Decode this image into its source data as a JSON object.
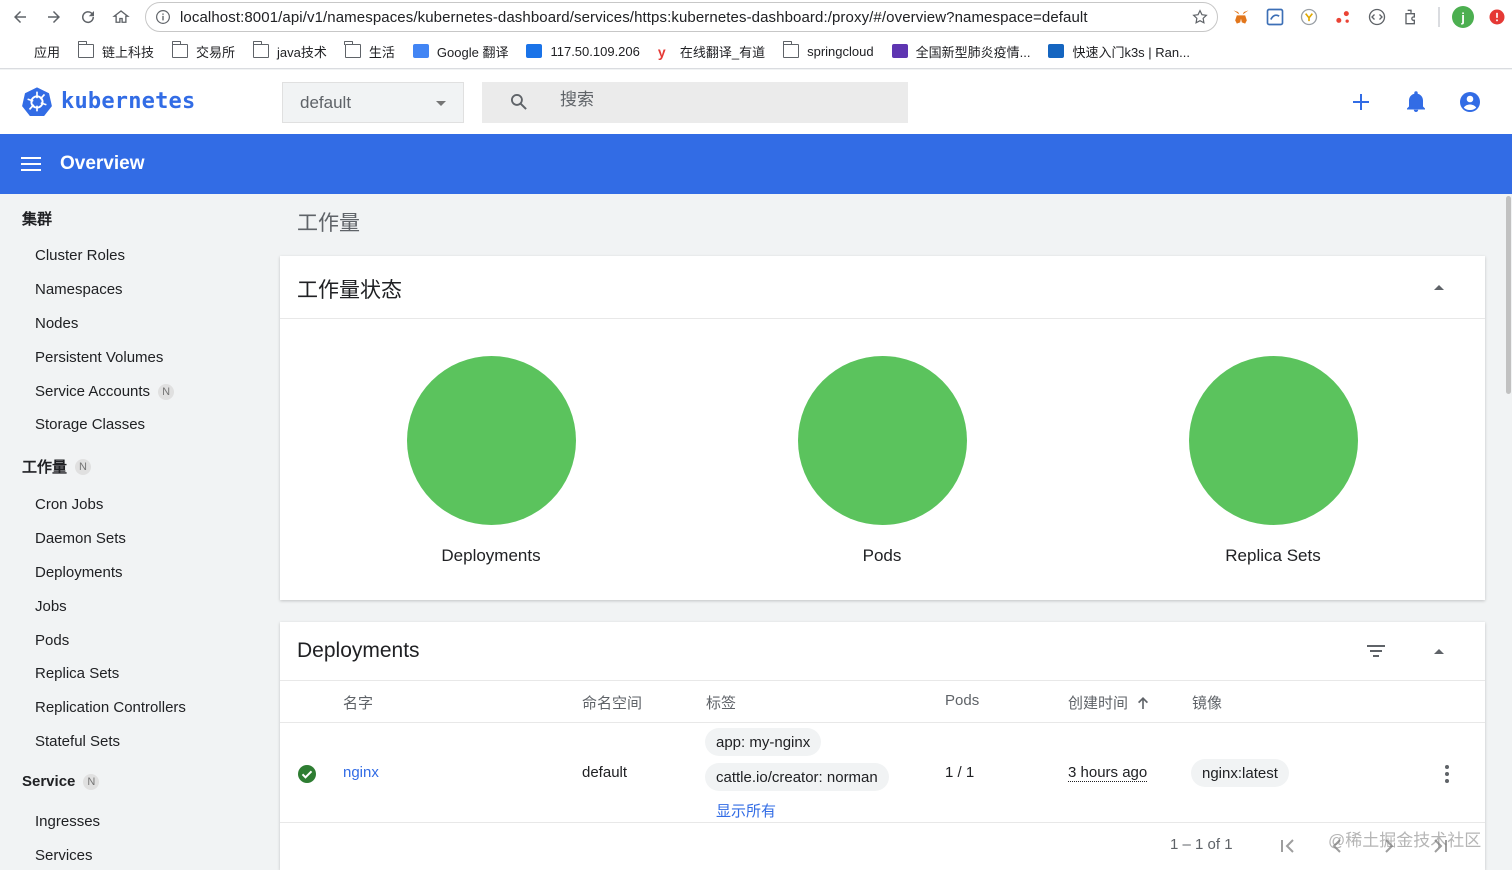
{
  "browser": {
    "url": "localhost:8001/api/v1/namespaces/kubernetes-dashboard/services/https:kubernetes-dashboard:/proxy/#/overview?namespace=default",
    "bookmarks": [
      {
        "label": "应用",
        "icon": "apps-grid-icon"
      },
      {
        "label": "链上科技",
        "icon": "folder-icon"
      },
      {
        "label": "交易所",
        "icon": "folder-icon"
      },
      {
        "label": "java技术",
        "icon": "folder-icon"
      },
      {
        "label": "生活",
        "icon": "folder-icon"
      },
      {
        "label": "Google 翻译",
        "icon": "translate-icon"
      },
      {
        "label": "117.50.109.206",
        "icon": "site-icon"
      },
      {
        "label": "在线翻译_有道",
        "icon": "youdao-icon"
      },
      {
        "label": "springcloud",
        "icon": "folder-icon"
      },
      {
        "label": "全国新型肺炎疫情...",
        "icon": "site-icon"
      },
      {
        "label": "快速入门k3s | Ran...",
        "icon": "shirt-icon"
      }
    ],
    "profile_initial": "j"
  },
  "header": {
    "brand": "kubernetes",
    "namespace": "default",
    "search_placeholder": "搜索"
  },
  "toolbar": {
    "title": "Overview"
  },
  "sidebar": {
    "cluster_label": "集群",
    "cluster_items": [
      "Cluster Roles",
      "Namespaces",
      "Nodes",
      "Persistent Volumes",
      "Service Accounts",
      "Storage Classes"
    ],
    "service_accounts_badge": "N",
    "workload_label": "工作量",
    "workload_badge": "N",
    "workload_items": [
      "Cron Jobs",
      "Daemon Sets",
      "Deployments",
      "Jobs",
      "Pods",
      "Replica Sets",
      "Replication Controllers",
      "Stateful Sets"
    ],
    "service_label": "Service",
    "service_badge": "N",
    "service_items": [
      "Ingresses",
      "Services"
    ]
  },
  "main": {
    "heading": "工作量",
    "status_card": {
      "title": "工作量状态",
      "charts": [
        {
          "label": "Deployments",
          "color": "#5bc35d"
        },
        {
          "label": "Pods",
          "color": "#5bc35d"
        },
        {
          "label": "Replica Sets",
          "color": "#5bc35d"
        }
      ]
    },
    "deployments_card": {
      "title": "Deployments",
      "columns": {
        "name": "名字",
        "namespace": "命名空间",
        "labels": "标签",
        "pods": "Pods",
        "created": "创建时间",
        "images": "镜像"
      },
      "rows": [
        {
          "name": "nginx",
          "namespace": "default",
          "labels": [
            "app: my-nginx",
            "cattle.io/creator: norman"
          ],
          "show_all": "显示所有",
          "pods": "1 / 1",
          "created": "3 hours ago",
          "image": "nginx:latest"
        }
      ],
      "pagination": "1 – 1 of 1"
    }
  },
  "watermark": "@稀土掘金技术社区",
  "colors": {
    "brand_blue": "#326ce5",
    "status_green": "#5bc35d"
  }
}
